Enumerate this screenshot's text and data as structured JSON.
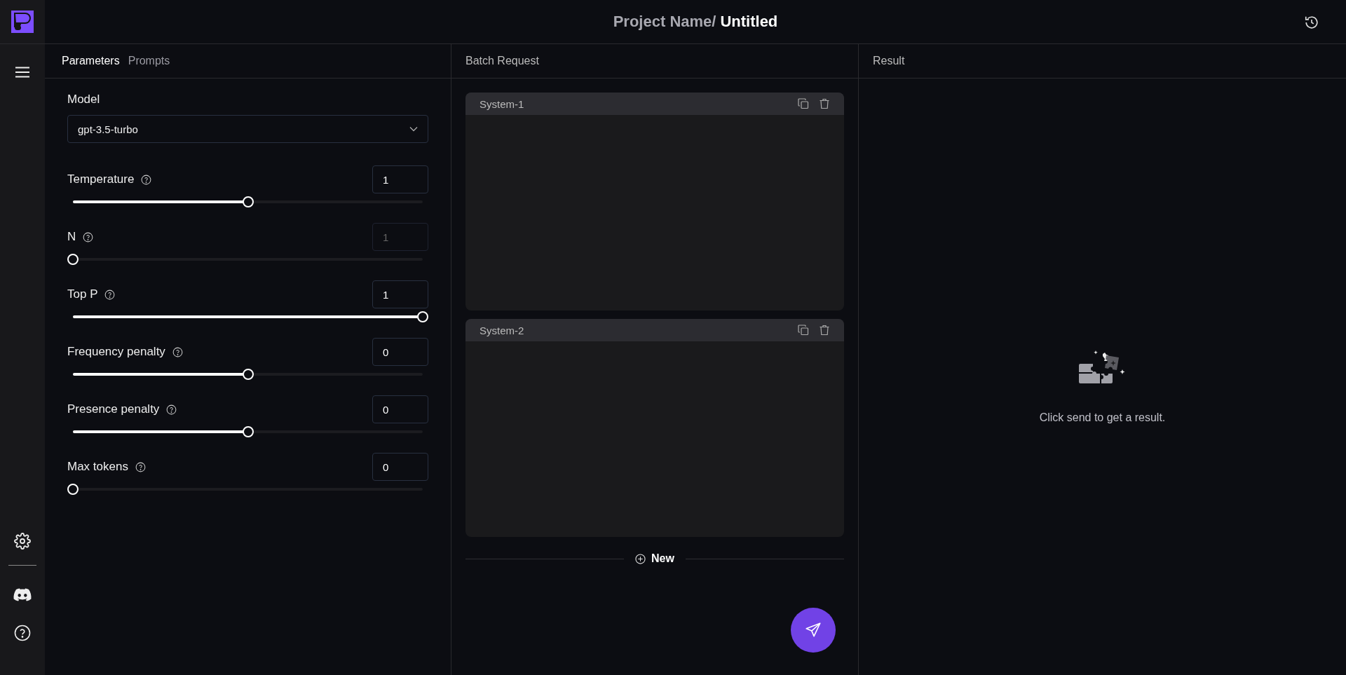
{
  "header": {
    "project": "Project Name/",
    "title": "Untitled"
  },
  "tabs": [
    {
      "label": "Parameters",
      "selected": true
    },
    {
      "label": "Prompts",
      "selected": false
    }
  ],
  "model": {
    "label": "Model",
    "value": "gpt-3.5-turbo"
  },
  "params": [
    {
      "label": "Temperature",
      "value": "1",
      "level": 0.5,
      "disabled": false
    },
    {
      "label": "N",
      "value": "1",
      "level": 0,
      "disabled": true
    },
    {
      "label": "Top P",
      "value": "1",
      "level": 1,
      "disabled": false
    },
    {
      "label": "Frequency penalty",
      "value": "0",
      "level": 0.5,
      "disabled": false
    },
    {
      "label": "Presence penalty",
      "value": "0",
      "level": 0.5,
      "disabled": false
    },
    {
      "label": "Max tokens",
      "value": "0",
      "level": 0,
      "disabled": false
    }
  ],
  "batch": {
    "title": "Batch Request",
    "cards": [
      {
        "title": "System-1"
      },
      {
        "title": "System-2"
      }
    ],
    "new_label": "New"
  },
  "result": {
    "title": "Result",
    "empty_text": "Click send to get a result."
  }
}
